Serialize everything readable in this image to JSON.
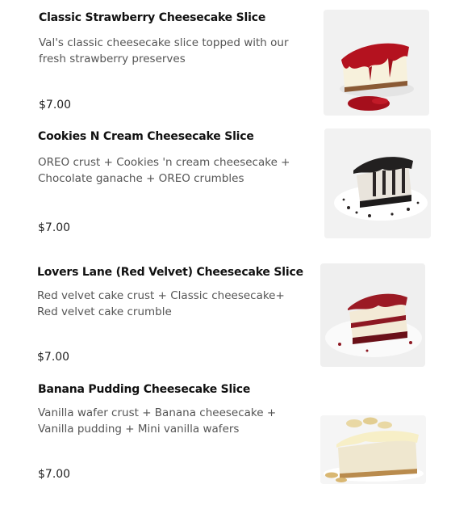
{
  "menu": {
    "items": [
      {
        "title": "Classic Strawberry Cheesecake Slice",
        "description": "Val's classic cheesecake slice topped with our fresh strawberry preserves",
        "price": "$7.00",
        "image": "strawberry-cheesecake-photo"
      },
      {
        "title": "Cookies N Cream Cheesecake Slice",
        "description": "OREO crust + Cookies 'n cream cheesecake + Chocolate ganache + OREO crumbles",
        "price": "$7.00",
        "image": "cookies-n-cream-cheesecake-photo"
      },
      {
        "title": "Lovers Lane (Red Velvet) Cheesecake Slice",
        "description": "Red velvet cake crust + Classic cheesecake+ Red velvet cake crumble",
        "price": "$7.00",
        "image": "red-velvet-cheesecake-photo"
      },
      {
        "title": "Banana Pudding Cheesecake Slice",
        "description": "Vanilla wafer crust + Banana cheesecake + Vanilla pudding + Mini vanilla wafers",
        "price": "$7.00",
        "image": "banana-pudding-cheesecake-photo"
      }
    ]
  }
}
